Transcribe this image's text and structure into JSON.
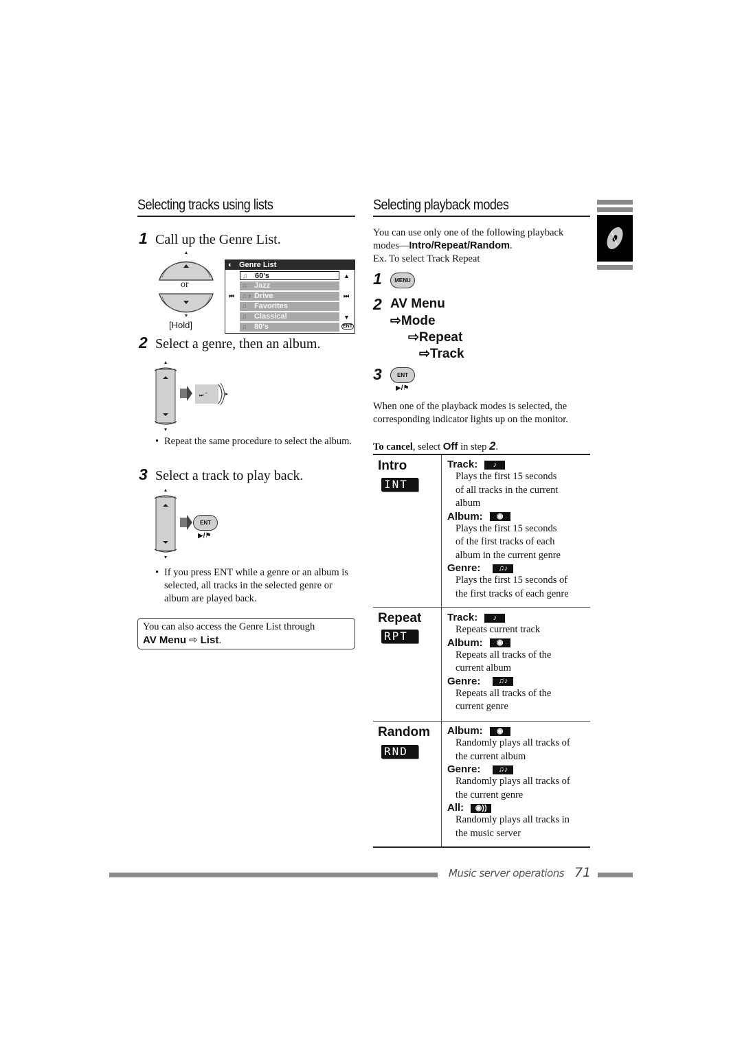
{
  "left": {
    "section_title": "Selecting tracks using lists",
    "step1": {
      "num": "1",
      "text": "Call up the Genre List.",
      "dial_or": "or",
      "hold_label": "[Hold]"
    },
    "genre_list": {
      "title": "Genre List",
      "items": [
        "60's",
        "Jazz",
        "Drive",
        "Favorites",
        "Classical",
        "80's"
      ],
      "selected_index": 0,
      "enter_label": "ENT"
    },
    "step2": {
      "num": "2",
      "text": "Select a genre, then an album.",
      "bullet": "Repeat the same procedure to select the album."
    },
    "step3": {
      "num": "3",
      "text": "Select a track to play back.",
      "button_label": "ENT",
      "button_sub": "▶/⚑",
      "bullet": "If you press ENT while a genre or an album is selected, all tracks in the selected genre or album are played back."
    },
    "note": {
      "text": "You can also access the Genre List through",
      "path_a": "AV Menu",
      "arrow": "⇨",
      "path_b": "List",
      "end": "."
    }
  },
  "right": {
    "section_title": "Selecting playback modes",
    "intro_text_1": "You can use only one of the following playback",
    "intro_text_2_prefix": "modes—",
    "intro_modes": "Intro/Repeat/Random",
    "intro_end": ".",
    "example": "Ex. To select Track Repeat",
    "step1": {
      "num": "1",
      "button_label": "MENU"
    },
    "step2": {
      "num": "2",
      "path": [
        "AV Menu",
        "⇨Mode",
        "⇨Repeat",
        "⇨Track"
      ]
    },
    "step3": {
      "num": "3",
      "button_label": "ENT",
      "button_sub": "▶/⚑"
    },
    "after_text": "When one of the playback modes is selected, the corresponding indicator lights up on the monitor.",
    "cancel": {
      "bold": "To cancel",
      "mid": ", select ",
      "off": "Off",
      "in_step": " in step ",
      "step": "2",
      "end": "."
    },
    "modes": [
      {
        "name": "Intro",
        "badge": "INT",
        "options": [
          {
            "label": "Track",
            "icon": "track-note",
            "glyph": "♪",
            "desc": [
              "Plays the first 15 seconds",
              "of all tracks in the current",
              "album"
            ]
          },
          {
            "label": "Album",
            "icon": "album-disc",
            "glyph": "◉",
            "desc": [
              "Plays the first 15 seconds",
              "of the first tracks of each",
              "album in the current genre"
            ]
          },
          {
            "label": "Genre",
            "icon": "genre-notes",
            "glyph": "♫♪",
            "desc": [
              "Plays the first 15 seconds of",
              "the first tracks of each genre"
            ]
          }
        ]
      },
      {
        "name": "Repeat",
        "badge": "RPT",
        "options": [
          {
            "label": "Track",
            "icon": "track-note",
            "glyph": "♪",
            "desc": [
              "Repeats current track"
            ]
          },
          {
            "label": "Album",
            "icon": "album-disc",
            "glyph": "◉",
            "desc": [
              "Repeats all tracks of the",
              "current album"
            ]
          },
          {
            "label": "Genre",
            "icon": "genre-notes",
            "glyph": "♫♪",
            "desc": [
              "Repeats all tracks of the",
              "current genre"
            ]
          }
        ]
      },
      {
        "name": "Random",
        "badge": "RND",
        "options": [
          {
            "label": "Album",
            "icon": "album-disc",
            "glyph": "◉",
            "desc": [
              "Randomly plays all tracks of",
              "the current album"
            ]
          },
          {
            "label": "Genre",
            "icon": "genre-notes",
            "glyph": "♫♪",
            "desc": [
              "Randomly plays all tracks of",
              "the current genre"
            ]
          },
          {
            "label": "All",
            "icon": "all-disc",
            "glyph": "◉))",
            "desc": [
              "Randomly plays all tracks in",
              "the music server"
            ]
          }
        ]
      }
    ]
  },
  "footer": {
    "section": "Music server operations",
    "page": "71"
  },
  "colors": {
    "ink": "#111111",
    "gray_bar": "#8a8a8a",
    "list_row": "#a9a9a9",
    "panel": "#d0d0d0"
  }
}
